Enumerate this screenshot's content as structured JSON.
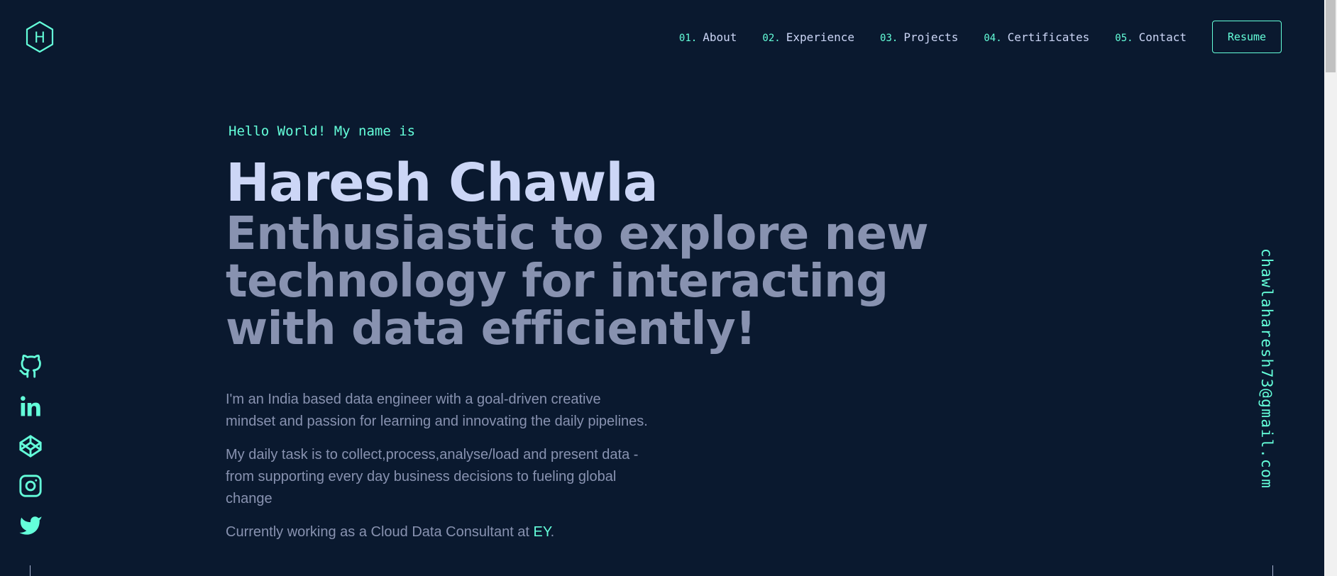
{
  "logo": {
    "letter": "H",
    "icon": "hexagon-logo-icon"
  },
  "nav": {
    "items": [
      {
        "num": "01.",
        "label": "About"
      },
      {
        "num": "02.",
        "label": "Experience"
      },
      {
        "num": "03.",
        "label": "Projects"
      },
      {
        "num": "04.",
        "label": "Certificates"
      },
      {
        "num": "05.",
        "label": "Contact"
      }
    ],
    "resume_label": "Resume"
  },
  "hero": {
    "greeting": "Hello World! My name is",
    "name": "Haresh Chawla",
    "tagline": "Enthusiastic to explore new technology for interacting with data efficiently!",
    "bio": [
      "I'm an India based data engineer with a goal-driven creative mindset and passion for learning and innovating the daily pipelines.",
      "My daily task is to collect,process,analyse/load and present data - from supporting every day business decisions to fueling global change"
    ],
    "current_prefix": "Currently working as a Cloud Data Consultant at ",
    "current_company": "EY",
    "current_suffix": "."
  },
  "social": [
    "github-icon",
    "linkedin-icon",
    "codepen-icon",
    "instagram-icon",
    "twitter-icon"
  ],
  "email": "chawlaharesh73@gmail.com",
  "colors": {
    "background": "#0a192f",
    "accent": "#64ffda",
    "heading": "#ccd6f6",
    "text": "#8892b0"
  }
}
